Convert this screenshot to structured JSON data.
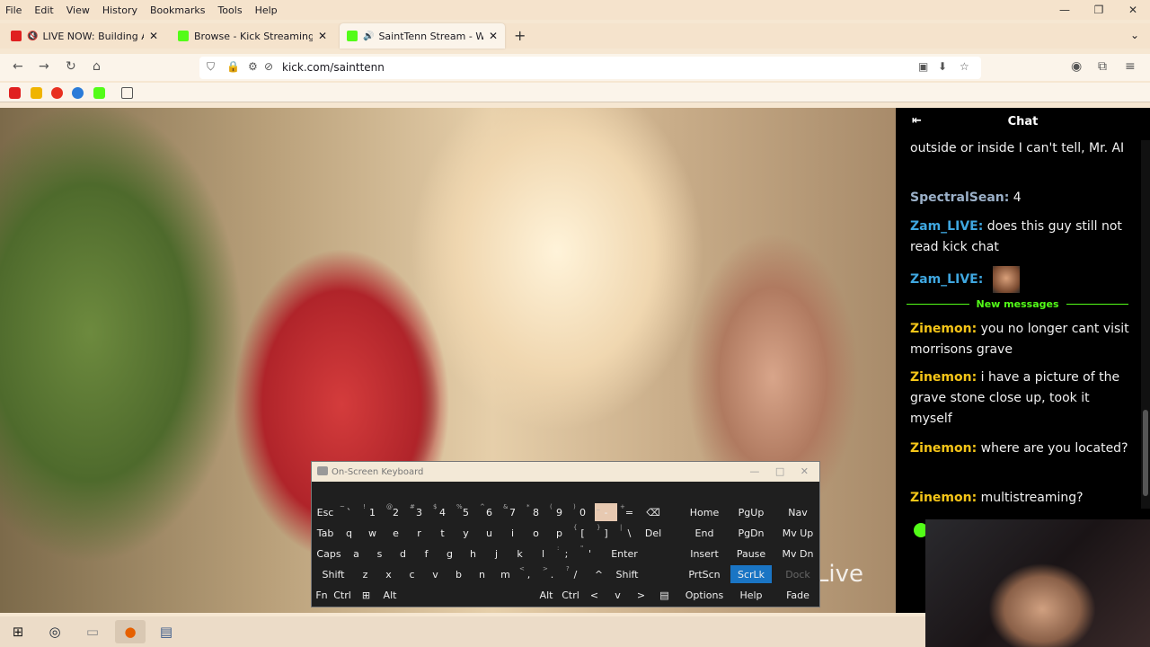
{
  "menu": [
    "File",
    "Edit",
    "View",
    "History",
    "Bookmarks",
    "Tools",
    "Help"
  ],
  "window_controls": {
    "minimize": "—",
    "restore": "❐",
    "close": "✕"
  },
  "tabs": [
    {
      "title": "LIVE NOW: Building A Lega",
      "favicon_color": "#e02020",
      "muted": true
    },
    {
      "title": "Browse - Kick Streaming",
      "favicon_color": "#53fc18",
      "muted": false
    },
    {
      "title": "SaintTenn Stream - Watch L",
      "favicon_color": "#53fc18",
      "muted": false,
      "active": true
    }
  ],
  "new_tab_label": "+",
  "url": "kick.com/sainttenn",
  "bookmark_colors": [
    "#e02020",
    "#f0b400",
    "#e83020",
    "#2a7bd8",
    "#53fc18"
  ],
  "video": {
    "watermark": "Live"
  },
  "osk": {
    "title": "On-Screen Keyboard",
    "rows": [
      [
        {
          "label": "Esc",
          "sub": ""
        },
        {
          "label": "`",
          "sub": "~"
        },
        {
          "label": "1",
          "sub": "!"
        },
        {
          "label": "2",
          "sub": "@"
        },
        {
          "label": "3",
          "sub": "#"
        },
        {
          "label": "4",
          "sub": "$"
        },
        {
          "label": "5",
          "sub": "%"
        },
        {
          "label": "6",
          "sub": "^"
        },
        {
          "label": "7",
          "sub": "&"
        },
        {
          "label": "8",
          "sub": "*"
        },
        {
          "label": "9",
          "sub": "("
        },
        {
          "label": "0",
          "sub": ")"
        },
        {
          "label": "-",
          "sub": "_"
        },
        {
          "label": "=",
          "sub": "+"
        },
        {
          "label": "⌫",
          "sub": ""
        }
      ],
      [
        {
          "label": "Tab",
          "sub": ""
        },
        {
          "label": "q",
          "sub": ""
        },
        {
          "label": "w",
          "sub": ""
        },
        {
          "label": "e",
          "sub": ""
        },
        {
          "label": "r",
          "sub": ""
        },
        {
          "label": "t",
          "sub": ""
        },
        {
          "label": "y",
          "sub": ""
        },
        {
          "label": "u",
          "sub": ""
        },
        {
          "label": "i",
          "sub": ""
        },
        {
          "label": "o",
          "sub": ""
        },
        {
          "label": "p",
          "sub": ""
        },
        {
          "label": "[",
          "sub": "{"
        },
        {
          "label": "]",
          "sub": "}"
        },
        {
          "label": "\\",
          "sub": "|"
        },
        {
          "label": "Del",
          "sub": ""
        }
      ],
      [
        {
          "label": "Caps",
          "sub": ""
        },
        {
          "label": "a",
          "sub": ""
        },
        {
          "label": "s",
          "sub": ""
        },
        {
          "label": "d",
          "sub": ""
        },
        {
          "label": "f",
          "sub": ""
        },
        {
          "label": "g",
          "sub": ""
        },
        {
          "label": "h",
          "sub": ""
        },
        {
          "label": "j",
          "sub": ""
        },
        {
          "label": "k",
          "sub": ""
        },
        {
          "label": "l",
          "sub": ""
        },
        {
          "label": ";",
          "sub": ":"
        },
        {
          "label": "'",
          "sub": "\""
        },
        {
          "label": "Enter",
          "sub": ""
        }
      ],
      [
        {
          "label": "Shift",
          "sub": ""
        },
        {
          "label": "z",
          "sub": ""
        },
        {
          "label": "x",
          "sub": ""
        },
        {
          "label": "c",
          "sub": ""
        },
        {
          "label": "v",
          "sub": ""
        },
        {
          "label": "b",
          "sub": ""
        },
        {
          "label": "n",
          "sub": ""
        },
        {
          "label": "m",
          "sub": ""
        },
        {
          "label": ",",
          "sub": "<"
        },
        {
          "label": ".",
          "sub": ">"
        },
        {
          "label": "/",
          "sub": "?"
        },
        {
          "label": "^",
          "sub": ""
        },
        {
          "label": "Shift",
          "sub": ""
        }
      ],
      [
        {
          "label": "Fn",
          "sub": ""
        },
        {
          "label": "Ctrl",
          "sub": ""
        },
        {
          "label": "⊞",
          "sub": ""
        },
        {
          "label": "Alt",
          "sub": ""
        },
        {
          "label": "Alt",
          "sub": ""
        },
        {
          "label": "Ctrl",
          "sub": ""
        },
        {
          "label": "<",
          "sub": ""
        },
        {
          "label": "v",
          "sub": ""
        },
        {
          "label": ">",
          "sub": ""
        },
        {
          "label": "▤",
          "sub": ""
        }
      ]
    ],
    "side": [
      [
        "Home",
        "PgUp",
        "Nav"
      ],
      [
        "End",
        "PgDn",
        "Mv Up"
      ],
      [
        "Insert",
        "Pause",
        "Mv Dn"
      ],
      [
        "PrtScn",
        "ScrLk",
        "Dock"
      ],
      [
        "Options",
        "Help",
        "Fade"
      ]
    ]
  },
  "chat": {
    "title": "Chat",
    "new_messages_label": "New messages",
    "messages": [
      {
        "user": "",
        "text": "outside or inside I can't tell, Mr. AI",
        "color": "#ffffff"
      },
      {
        "user": "SpectralSean:",
        "text": " 4",
        "color": "#9bb0c8"
      },
      {
        "user": "Zam_LIVE:",
        "text": " does this guy still not read kick chat",
        "color": "#3fa7e0"
      },
      {
        "user": "Zam_LIVE:",
        "text": "",
        "color": "#3fa7e0"
      },
      {
        "user": "Zinemon:",
        "text": " you no longer cant visit morrisons grave",
        "color": "#f5c518"
      },
      {
        "user": "Zinemon:",
        "text": " i have a picture of the grave stone close up, took it myself",
        "color": "#f5c518"
      },
      {
        "user": "Zinemon:",
        "text": " where are you located?",
        "color": "#f5c518"
      },
      {
        "user": "Zinemon:",
        "text": " multistreaming?",
        "color": "#f5c518"
      }
    ]
  },
  "taskbar_icons": [
    "windows-icon",
    "steam-icon",
    "file-explorer-icon",
    "firefox-icon",
    "monitor-app-icon"
  ]
}
